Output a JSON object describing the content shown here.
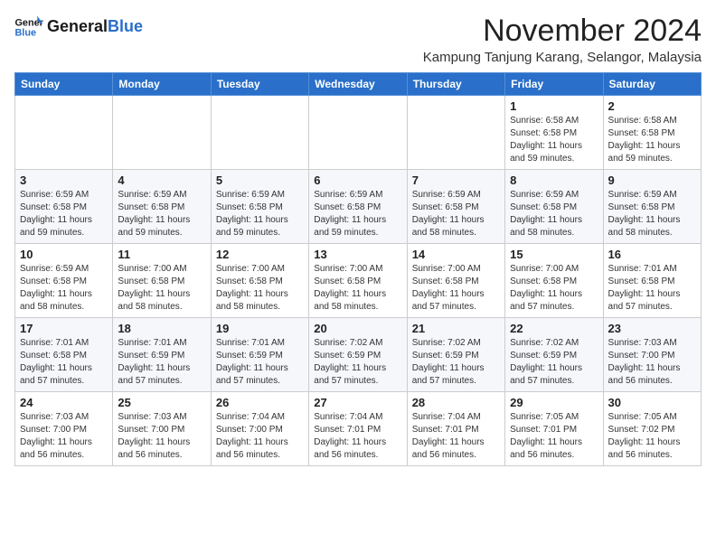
{
  "header": {
    "logo_general": "General",
    "logo_blue": "Blue",
    "month_year": "November 2024",
    "location": "Kampung Tanjung Karang, Selangor, Malaysia"
  },
  "days_of_week": [
    "Sunday",
    "Monday",
    "Tuesday",
    "Wednesday",
    "Thursday",
    "Friday",
    "Saturday"
  ],
  "weeks": [
    [
      {
        "day": "",
        "info": ""
      },
      {
        "day": "",
        "info": ""
      },
      {
        "day": "",
        "info": ""
      },
      {
        "day": "",
        "info": ""
      },
      {
        "day": "",
        "info": ""
      },
      {
        "day": "1",
        "info": "Sunrise: 6:58 AM\nSunset: 6:58 PM\nDaylight: 11 hours and 59 minutes."
      },
      {
        "day": "2",
        "info": "Sunrise: 6:58 AM\nSunset: 6:58 PM\nDaylight: 11 hours and 59 minutes."
      }
    ],
    [
      {
        "day": "3",
        "info": "Sunrise: 6:59 AM\nSunset: 6:58 PM\nDaylight: 11 hours and 59 minutes."
      },
      {
        "day": "4",
        "info": "Sunrise: 6:59 AM\nSunset: 6:58 PM\nDaylight: 11 hours and 59 minutes."
      },
      {
        "day": "5",
        "info": "Sunrise: 6:59 AM\nSunset: 6:58 PM\nDaylight: 11 hours and 59 minutes."
      },
      {
        "day": "6",
        "info": "Sunrise: 6:59 AM\nSunset: 6:58 PM\nDaylight: 11 hours and 59 minutes."
      },
      {
        "day": "7",
        "info": "Sunrise: 6:59 AM\nSunset: 6:58 PM\nDaylight: 11 hours and 58 minutes."
      },
      {
        "day": "8",
        "info": "Sunrise: 6:59 AM\nSunset: 6:58 PM\nDaylight: 11 hours and 58 minutes."
      },
      {
        "day": "9",
        "info": "Sunrise: 6:59 AM\nSunset: 6:58 PM\nDaylight: 11 hours and 58 minutes."
      }
    ],
    [
      {
        "day": "10",
        "info": "Sunrise: 6:59 AM\nSunset: 6:58 PM\nDaylight: 11 hours and 58 minutes."
      },
      {
        "day": "11",
        "info": "Sunrise: 7:00 AM\nSunset: 6:58 PM\nDaylight: 11 hours and 58 minutes."
      },
      {
        "day": "12",
        "info": "Sunrise: 7:00 AM\nSunset: 6:58 PM\nDaylight: 11 hours and 58 minutes."
      },
      {
        "day": "13",
        "info": "Sunrise: 7:00 AM\nSunset: 6:58 PM\nDaylight: 11 hours and 58 minutes."
      },
      {
        "day": "14",
        "info": "Sunrise: 7:00 AM\nSunset: 6:58 PM\nDaylight: 11 hours and 57 minutes."
      },
      {
        "day": "15",
        "info": "Sunrise: 7:00 AM\nSunset: 6:58 PM\nDaylight: 11 hours and 57 minutes."
      },
      {
        "day": "16",
        "info": "Sunrise: 7:01 AM\nSunset: 6:58 PM\nDaylight: 11 hours and 57 minutes."
      }
    ],
    [
      {
        "day": "17",
        "info": "Sunrise: 7:01 AM\nSunset: 6:58 PM\nDaylight: 11 hours and 57 minutes."
      },
      {
        "day": "18",
        "info": "Sunrise: 7:01 AM\nSunset: 6:59 PM\nDaylight: 11 hours and 57 minutes."
      },
      {
        "day": "19",
        "info": "Sunrise: 7:01 AM\nSunset: 6:59 PM\nDaylight: 11 hours and 57 minutes."
      },
      {
        "day": "20",
        "info": "Sunrise: 7:02 AM\nSunset: 6:59 PM\nDaylight: 11 hours and 57 minutes."
      },
      {
        "day": "21",
        "info": "Sunrise: 7:02 AM\nSunset: 6:59 PM\nDaylight: 11 hours and 57 minutes."
      },
      {
        "day": "22",
        "info": "Sunrise: 7:02 AM\nSunset: 6:59 PM\nDaylight: 11 hours and 57 minutes."
      },
      {
        "day": "23",
        "info": "Sunrise: 7:03 AM\nSunset: 7:00 PM\nDaylight: 11 hours and 56 minutes."
      }
    ],
    [
      {
        "day": "24",
        "info": "Sunrise: 7:03 AM\nSunset: 7:00 PM\nDaylight: 11 hours and 56 minutes."
      },
      {
        "day": "25",
        "info": "Sunrise: 7:03 AM\nSunset: 7:00 PM\nDaylight: 11 hours and 56 minutes."
      },
      {
        "day": "26",
        "info": "Sunrise: 7:04 AM\nSunset: 7:00 PM\nDaylight: 11 hours and 56 minutes."
      },
      {
        "day": "27",
        "info": "Sunrise: 7:04 AM\nSunset: 7:01 PM\nDaylight: 11 hours and 56 minutes."
      },
      {
        "day": "28",
        "info": "Sunrise: 7:04 AM\nSunset: 7:01 PM\nDaylight: 11 hours and 56 minutes."
      },
      {
        "day": "29",
        "info": "Sunrise: 7:05 AM\nSunset: 7:01 PM\nDaylight: 11 hours and 56 minutes."
      },
      {
        "day": "30",
        "info": "Sunrise: 7:05 AM\nSunset: 7:02 PM\nDaylight: 11 hours and 56 minutes."
      }
    ]
  ]
}
